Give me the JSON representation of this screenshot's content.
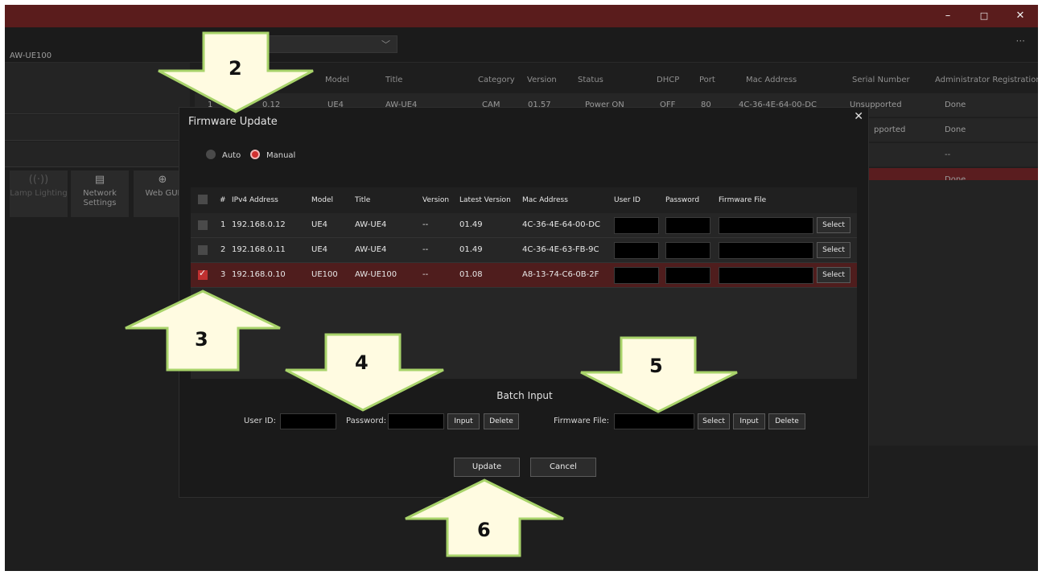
{
  "window": {
    "minimize": "–",
    "maximize": "□",
    "close": "✕"
  },
  "toolbar": {
    "device_name": "AW-UE100",
    "more": "···"
  },
  "left_panel": {
    "buttons": [
      {
        "label": "Lamp Lighting",
        "icon": "signal-icon",
        "glyph": "((·))"
      },
      {
        "label": "Network Settings",
        "icon": "network-settings-icon",
        "glyph": "▤"
      },
      {
        "label": "Web GUI",
        "icon": "globe-icon",
        "glyph": "⊕"
      }
    ]
  },
  "bg_table": {
    "headers": [
      "Model",
      "Title",
      "Category",
      "Version",
      "Status",
      "DHCP",
      "Port",
      "Mac Address",
      "Serial Number",
      "Administrator Registration"
    ],
    "row1": {
      "num": "1",
      "ip": "0.12",
      "model": "UE4",
      "title": "AW-UE4",
      "category": "CAM",
      "version": "01.57",
      "status": "Power ON",
      "dhcp": "OFF",
      "port": "80",
      "mac": "4C-36-4E-64-00-DC",
      "serial": "Unsupported",
      "admin": "Done"
    },
    "row2": {
      "serial": "pported",
      "admin": "Done"
    },
    "row3": {
      "admin": "--"
    },
    "row4": {
      "admin": "Done"
    }
  },
  "dialog": {
    "title": "Firmware Update",
    "close": "✕",
    "mode_auto": "Auto",
    "mode_manual": "Manual",
    "mode_selected": "Manual",
    "table_headers": {
      "num": "#",
      "ipv4": "IPv4 Address",
      "model": "Model",
      "title": "Title",
      "version": "Version",
      "latest": "Latest Version",
      "mac": "Mac Address",
      "userid": "User ID",
      "password": "Password",
      "fwfile": "Firmware File"
    },
    "rows": [
      {
        "num": "1",
        "ip": "192.168.0.12",
        "model": "UE4",
        "title": "AW-UE4",
        "version": "--",
        "latest": "01.49",
        "mac": "4C-36-4E-64-00-DC",
        "select": "Select",
        "checked": false
      },
      {
        "num": "2",
        "ip": "192.168.0.11",
        "model": "UE4",
        "title": "AW-UE4",
        "version": "--",
        "latest": "01.49",
        "mac": "4C-36-4E-63-FB-9C",
        "select": "Select",
        "checked": false
      },
      {
        "num": "3",
        "ip": "192.168.0.10",
        "model": "UE100",
        "title": "AW-UE100",
        "version": "--",
        "latest": "01.08",
        "mac": "A8-13-74-C6-0B-2F",
        "select": "Select",
        "checked": true
      }
    ],
    "batch": {
      "title": "Batch Input",
      "userid_label": "User ID:",
      "password_label": "Password:",
      "input": "Input",
      "delete": "Delete",
      "fw_label": "Firmware File:",
      "select": "Select",
      "input2": "Input",
      "delete2": "Delete"
    },
    "update": "Update",
    "cancel": "Cancel"
  },
  "annotations": {
    "a2": "2",
    "a3": "3",
    "a4": "4",
    "a5": "5",
    "a6": "6"
  },
  "colors": {
    "titlebar": "#5a1c1c",
    "selected_row": "#4f1d1d",
    "radio_on": "#d03030",
    "arrow_fill": "#fffbe1",
    "arrow_stroke": "#a8d36a"
  }
}
